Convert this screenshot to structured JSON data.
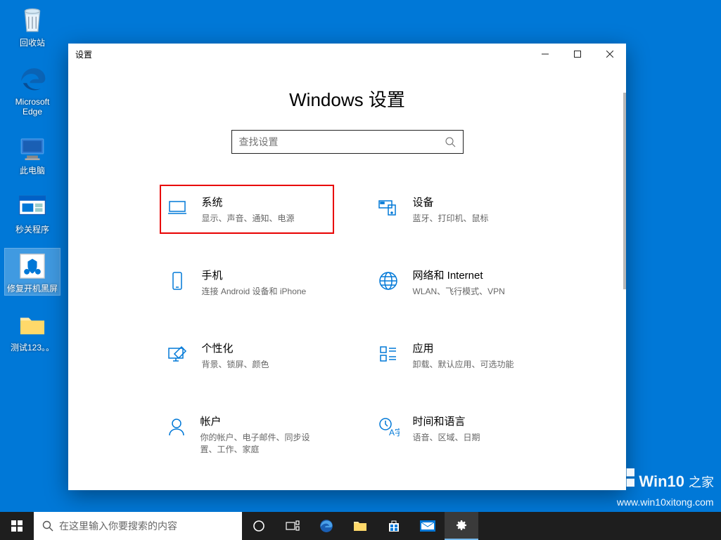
{
  "desktop": {
    "icons": [
      {
        "name": "recycle-bin-icon",
        "label": "回收站"
      },
      {
        "name": "edge-icon",
        "label": "Microsoft Edge"
      },
      {
        "name": "this-pc-icon",
        "label": "此电脑"
      },
      {
        "name": "shutdown-tool-icon",
        "label": "秒关程序"
      },
      {
        "name": "repair-tool-icon",
        "label": "修复开机黑屏"
      },
      {
        "name": "folder-icon",
        "label": "测试123。。"
      }
    ]
  },
  "window": {
    "title": "设置",
    "heading": "Windows 设置",
    "search_placeholder": "查找设置"
  },
  "categories": [
    {
      "key": "system",
      "title": "系统",
      "desc": "显示、声音、通知、电源",
      "icon": "laptop-icon",
      "highlighted": true
    },
    {
      "key": "devices",
      "title": "设备",
      "desc": "蓝牙、打印机、鼠标",
      "icon": "devices-icon"
    },
    {
      "key": "phone",
      "title": "手机",
      "desc": "连接 Android 设备和 iPhone",
      "icon": "phone-icon"
    },
    {
      "key": "network",
      "title": "网络和 Internet",
      "desc": "WLAN、飞行模式、VPN",
      "icon": "globe-icon"
    },
    {
      "key": "personalization",
      "title": "个性化",
      "desc": "背景、锁屏、颜色",
      "icon": "personalize-icon"
    },
    {
      "key": "apps",
      "title": "应用",
      "desc": "卸载、默认应用、可选功能",
      "icon": "apps-icon"
    },
    {
      "key": "accounts",
      "title": "帐户",
      "desc": "你的帐户、电子邮件、同步设置、工作、家庭",
      "icon": "account-icon"
    },
    {
      "key": "time",
      "title": "时间和语言",
      "desc": "语音、区域、日期",
      "icon": "time-lang-icon"
    }
  ],
  "taskbar": {
    "search_placeholder": "在这里输入你要搜索的内容"
  },
  "watermark": {
    "brand": "Win10",
    "suffix": "之家",
    "url": "www.win10xitong.com"
  },
  "colors": {
    "accent": "#0078d7"
  }
}
